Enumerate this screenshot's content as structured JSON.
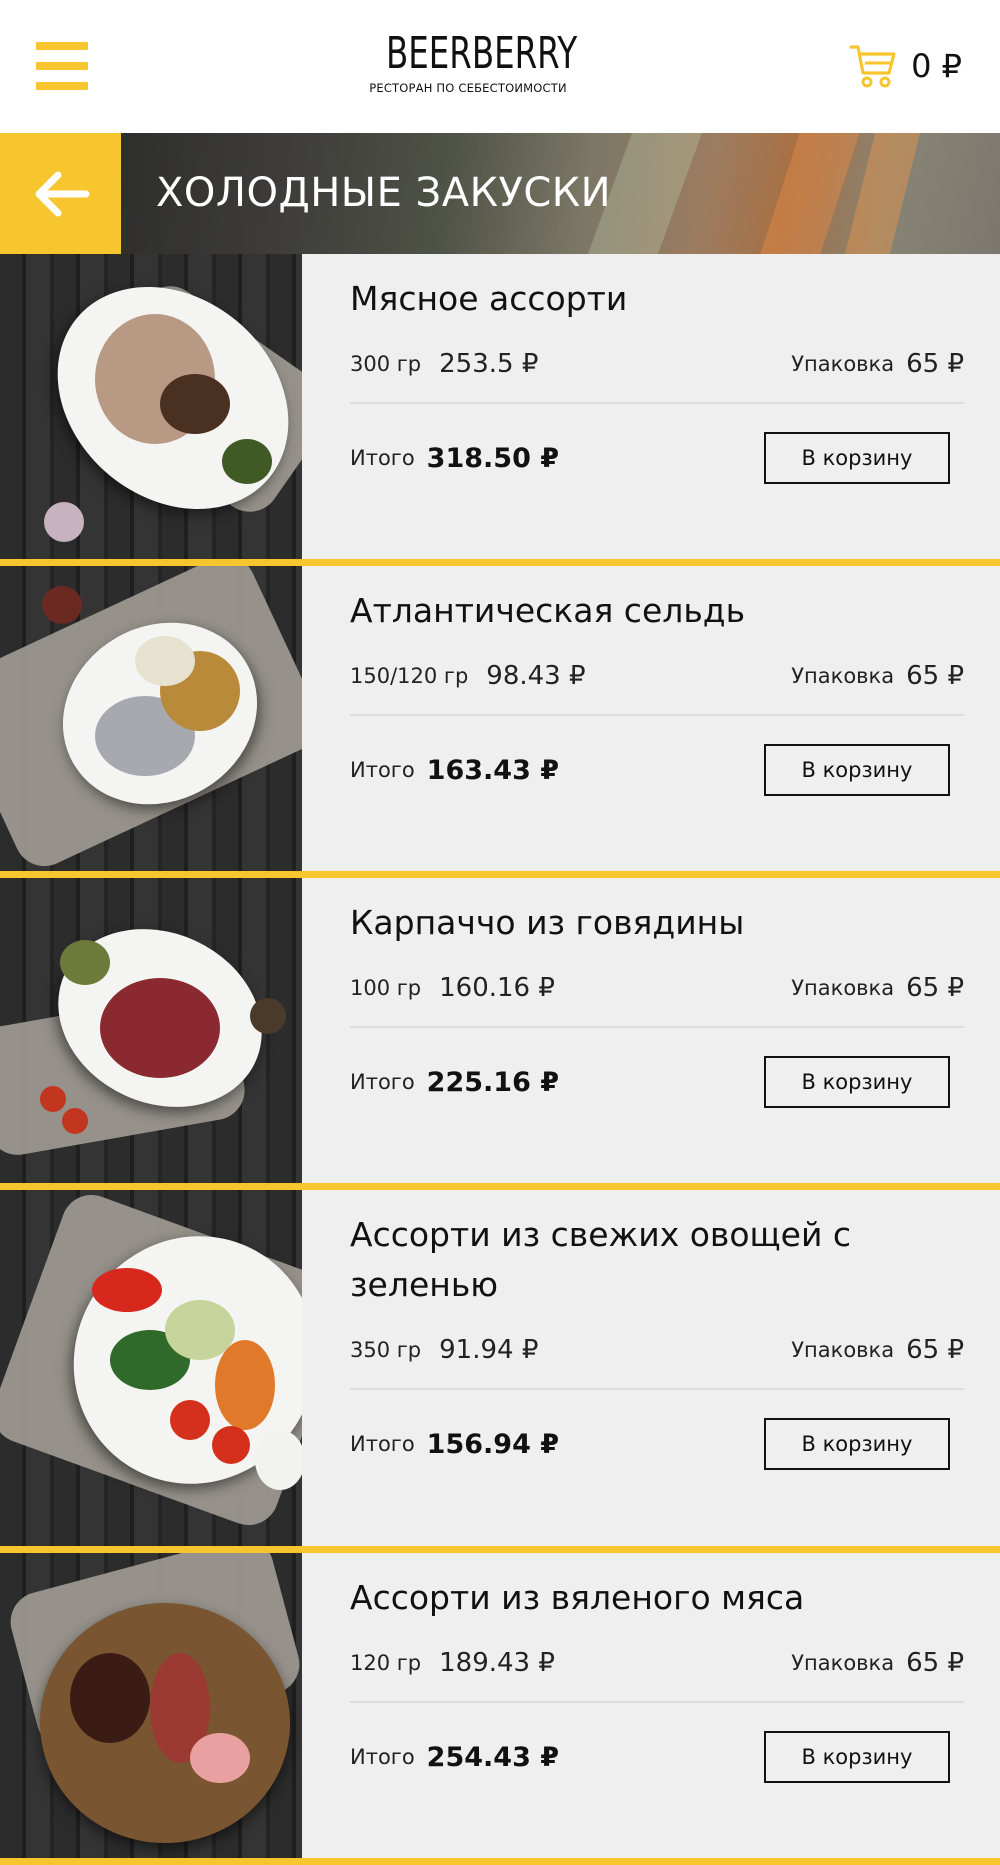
{
  "header": {
    "logo_main": "BEERBERRY",
    "logo_sub": "РЕСТОРАН ПО СЕБЕСТОИМОСТИ",
    "cart_total": "0 ₽",
    "menu_icon": "hamburger-icon",
    "cart_icon": "shopping-cart-icon"
  },
  "category": {
    "title": "ХОЛОДНЫЕ ЗАКУСКИ",
    "back_icon": "arrow-left-icon"
  },
  "labels": {
    "pack": "Упаковка",
    "total": "Итого",
    "add_to_cart": "В корзину"
  },
  "colors": {
    "accent": "#f7c62f",
    "card_bg": "#efefef"
  },
  "items": [
    {
      "name": "Мясное ассорти",
      "weight": "300 гр",
      "price": "253.5 ₽",
      "pack_price": "65 ₽",
      "total": "318.50 ₽"
    },
    {
      "name": "Атлантическая сельдь",
      "weight": "150/120 гр",
      "price": "98.43 ₽",
      "pack_price": "65 ₽",
      "total": "163.43 ₽"
    },
    {
      "name": "Карпаччо из говядины",
      "weight": "100 гр",
      "price": "160.16 ₽",
      "pack_price": "65 ₽",
      "total": "225.16 ₽"
    },
    {
      "name": "Ассорти из свежих овощей с зеленью",
      "weight": "350 гр",
      "price": "91.94 ₽",
      "pack_price": "65 ₽",
      "total": "156.94 ₽"
    },
    {
      "name": "Ассорти из вяленого мяса",
      "weight": "120 гр",
      "price": "189.43 ₽",
      "pack_price": "65 ₽",
      "total": "254.43 ₽"
    }
  ]
}
